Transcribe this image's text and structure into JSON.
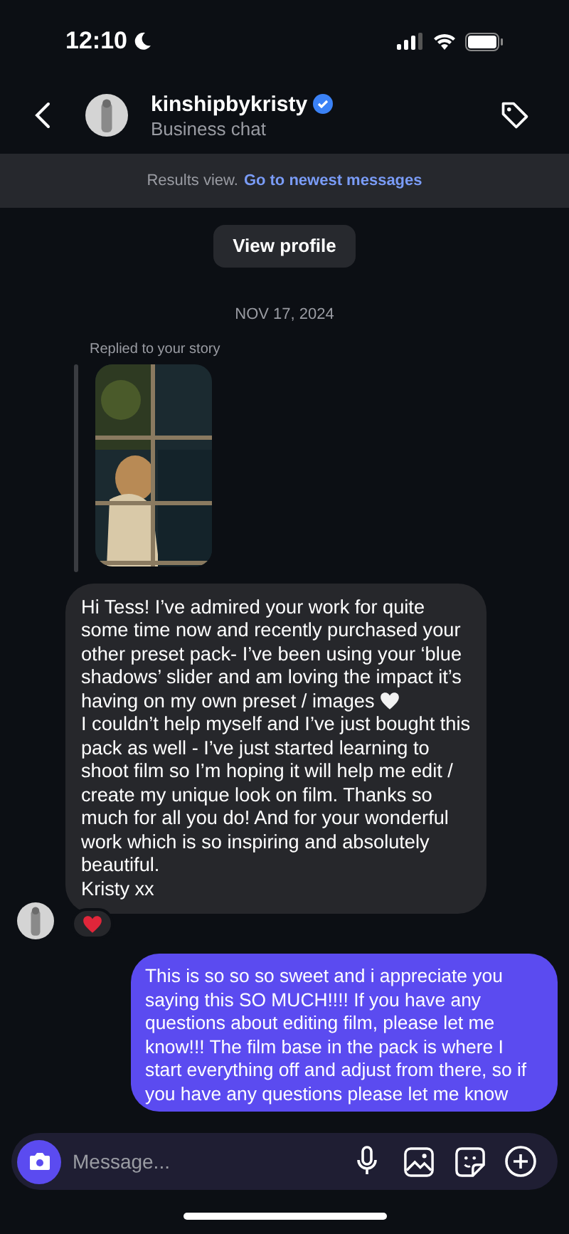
{
  "status_bar": {
    "time": "12:10"
  },
  "header": {
    "username": "kinshipbykristy",
    "verified": true,
    "subtitle": "Business chat"
  },
  "results_bar": {
    "text": "Results view.",
    "link": "Go to newest messages"
  },
  "view_profile_button": "View profile",
  "date": "NOV 17, 2024",
  "story_reply": {
    "label": "Replied to your story"
  },
  "messages": [
    {
      "kind": "incoming",
      "paragraphs": [
        "Hi Tess! I’ve admired your work for quite some time now and recently purchased your other preset pack- I’ve been using your ‘blue shadows’ slider and am loving the impact it’s having on my own preset / images",
        "I couldn’t help myself and I’ve just bought this pack as well - I’ve just started learning to shoot film so I’m hoping it will help me edit / create my unique look on film. Thanks so much for all you do! And for your wonderful work which is so inspiring and absolutely beautiful.",
        "Kristy xx"
      ],
      "heart_after_first": true,
      "reaction": true
    },
    {
      "kind": "outgoing",
      "paragraphs": [
        "This is so so so sweet and i appreciate you saying this SO MUCH!!!! If you have any questions about editing film, please let me know!!! The film base in the pack is where I start everything off and adjust from there, so if you have any questions please let me know"
      ]
    }
  ],
  "composer": {
    "placeholder": "Message..."
  }
}
